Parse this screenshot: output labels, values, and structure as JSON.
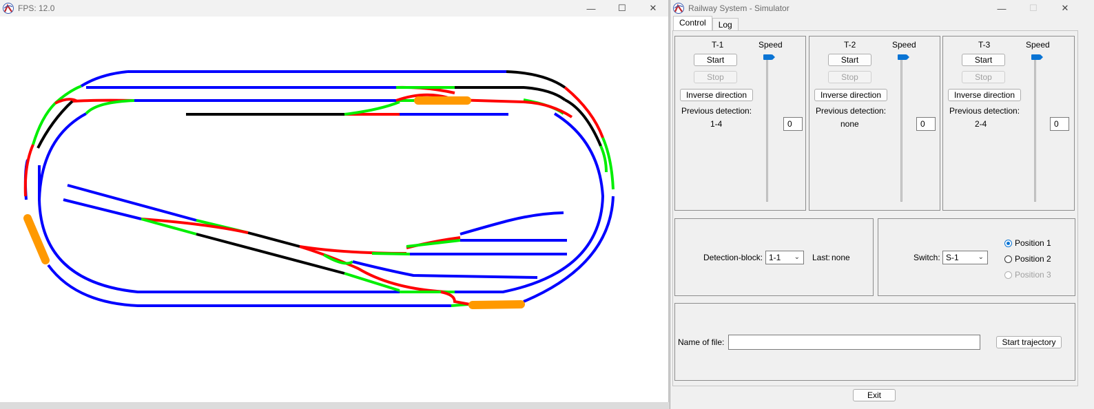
{
  "track_window": {
    "title": "FPS: 12.0",
    "controls": {
      "minimize": "—",
      "maximize": "☐",
      "close": "✕"
    }
  },
  "simulator": {
    "title": "Railway System - Simulator",
    "controls": {
      "minimize": "—",
      "maximize": "☐",
      "close": "✕"
    },
    "tabs": [
      {
        "label": "Control",
        "active": true
      },
      {
        "label": "Log",
        "active": false
      }
    ],
    "trains": [
      {
        "name": "T-1",
        "speed_label": "Speed",
        "start_label": "Start",
        "stop_label": "Stop",
        "inverse_label": "Inverse direction",
        "prev_detection_label": "Previous detection:",
        "prev_detection_value": "1-4",
        "speed_value": "0"
      },
      {
        "name": "T-2",
        "speed_label": "Speed",
        "start_label": "Start",
        "stop_label": "Stop",
        "inverse_label": "Inverse direction",
        "prev_detection_label": "Previous detection:",
        "prev_detection_value": "none",
        "speed_value": "0"
      },
      {
        "name": "T-3",
        "speed_label": "Speed",
        "start_label": "Start",
        "stop_label": "Stop",
        "inverse_label": "Inverse direction",
        "prev_detection_label": "Previous detection:",
        "prev_detection_value": "2-4",
        "speed_value": "0"
      }
    ],
    "detection": {
      "label": "Detection-block:",
      "value": "1-1",
      "last_label": "Last:",
      "last_value": "none"
    },
    "switch": {
      "label": "Switch:",
      "value": "S-1",
      "positions": [
        {
          "label": "Position 1",
          "state": "checked"
        },
        {
          "label": "Position 2",
          "state": "unchecked"
        },
        {
          "label": "Position 3",
          "state": "disabled"
        }
      ]
    },
    "trajectory": {
      "file_label": "Name of file:",
      "file_value": "",
      "start_label": "Start trajectory"
    },
    "exit_label": "Exit"
  },
  "colors": {
    "free_block": "#0000ff",
    "occupied_block": "#000000",
    "reserved_red": "#ff0000",
    "reserved_green": "#00ee00",
    "train": "#ff9900",
    "slider_accent": "#0a74d4"
  }
}
